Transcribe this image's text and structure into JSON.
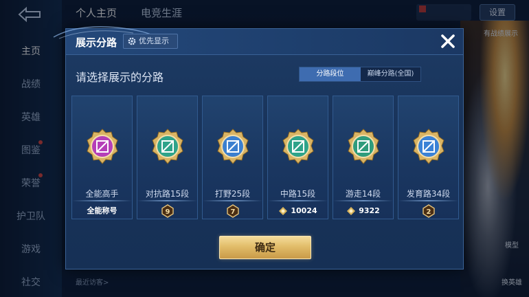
{
  "background": {
    "sidebar": [
      "主页",
      "战绩",
      "英雄",
      "图鉴",
      "荣誉",
      "护卫队",
      "游戏",
      "社交"
    ],
    "top_tabs": [
      "个人主页",
      "电竞生涯"
    ],
    "settings": "设置",
    "right_label": "有战绩展示",
    "right_buttons": [
      "模型",
      "换英雄"
    ],
    "recent_visitors": "最近访客>"
  },
  "modal": {
    "title": "展示分路",
    "priority_label": "优先显示",
    "subtitle": "请选择展示的分路",
    "tabs": [
      "分路段位",
      "巅峰分路(全国)"
    ],
    "active_tab": 0,
    "confirm": "确定",
    "accent": "#3e6cb0"
  },
  "cards": [
    {
      "rank": "全能高手",
      "footer": "全能称号",
      "footer_kind": "text",
      "color": "#b53fb8"
    },
    {
      "rank": "对抗路15段",
      "footer": "9",
      "footer_kind": "medal",
      "color": "#2fa38a"
    },
    {
      "rank": "打野25段",
      "footer": "7",
      "footer_kind": "medal",
      "color": "#3b7fcf"
    },
    {
      "rank": "中路15段",
      "footer": "10024",
      "footer_kind": "points",
      "color": "#2fa38a"
    },
    {
      "rank": "游走14段",
      "footer": "9322",
      "footer_kind": "points",
      "color": "#2f9c7c"
    },
    {
      "rank": "发育路34段",
      "footer": "2",
      "footer_kind": "medal",
      "color": "#3b82d6"
    }
  ]
}
